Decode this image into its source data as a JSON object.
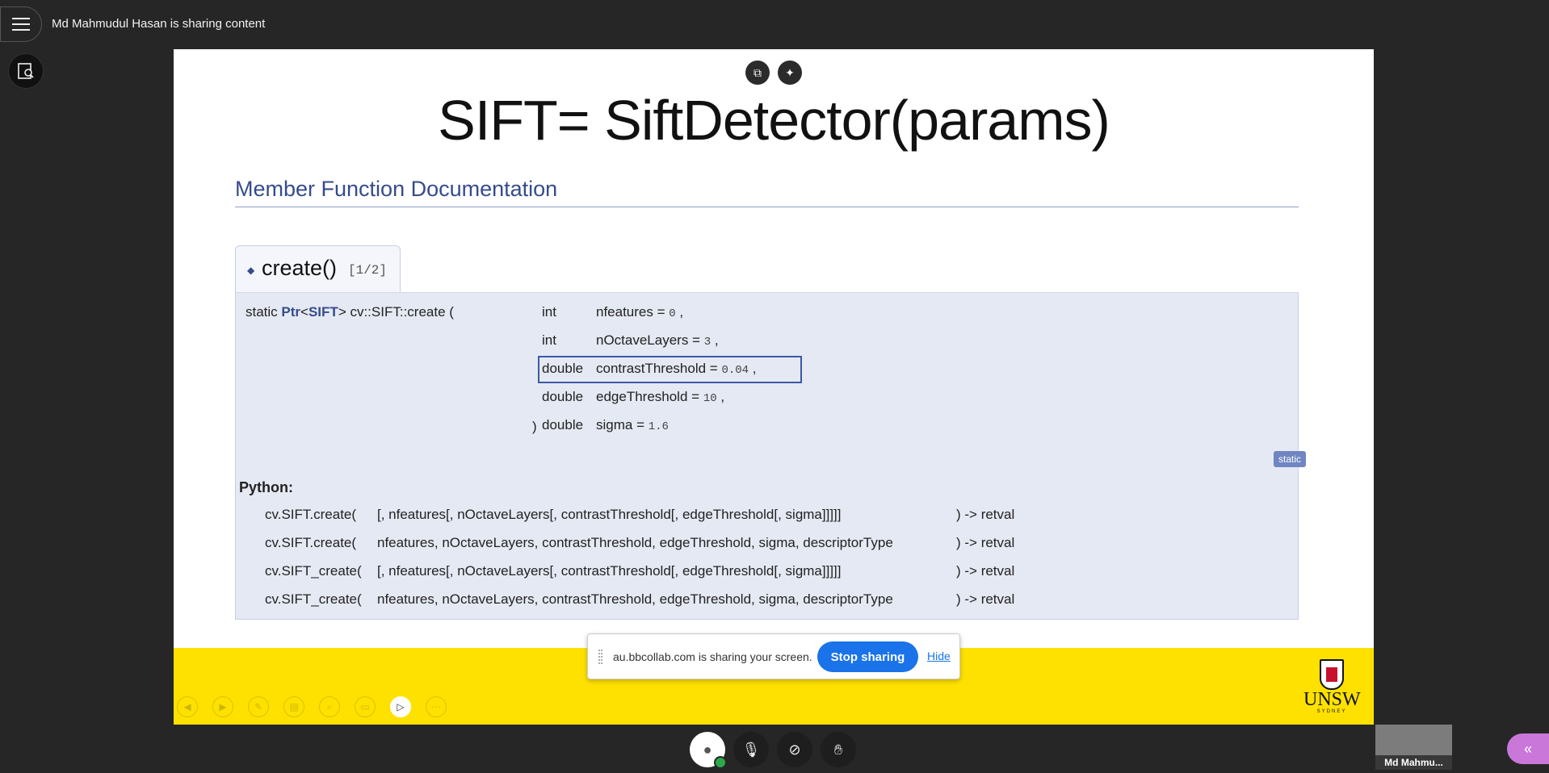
{
  "session": {
    "sharing_title": "Md Mahmudul Hasan is sharing content"
  },
  "slide": {
    "title": "SIFT= SiftDetector(params)",
    "doc_heading": "Member Function Documentation",
    "function_tab": {
      "name": "create()",
      "overload": "[1/2]"
    },
    "signature": {
      "prefix": "static Ptr<SIFT> cv::SIFT::create (",
      "prefix_ptr": "Ptr",
      "prefix_sift": "SIFT",
      "params": [
        {
          "type": "int",
          "name": "nfeatures =",
          "value": "0",
          "sep": ","
        },
        {
          "type": "int",
          "name": "nOctaveLayers =",
          "value": "3",
          "sep": ","
        },
        {
          "type": "double",
          "name": "contrastThreshold =",
          "value": "0.04",
          "sep": ","
        },
        {
          "type": "double",
          "name": "edgeThreshold =",
          "value": "10",
          "sep": ","
        },
        {
          "type": "double",
          "name": "sigma =",
          "value": "1.6",
          "sep": ""
        }
      ],
      "close": ")",
      "badge": "static"
    },
    "python": {
      "label": "Python:",
      "lines": [
        {
          "fn": "cv.SIFT.create(",
          "args": "[, nfeatures[, nOctaveLayers[, contrastThreshold[, edgeThreshold[, sigma]]]]]",
          "ret": ") -> retval"
        },
        {
          "fn": "cv.SIFT.create(",
          "args": "nfeatures, nOctaveLayers, contrastThreshold, edgeThreshold, sigma, descriptorType",
          "ret": ") -> retval"
        },
        {
          "fn": "cv.SIFT_create(",
          "args": "[, nfeatures[, nOctaveLayers[, contrastThreshold[, edgeThreshold[, sigma]]]]]",
          "ret": ") -> retval"
        },
        {
          "fn": "cv.SIFT_create(",
          "args": "nfeatures, nOctaveLayers, contrastThreshold, edgeThreshold, sigma, descriptorType",
          "ret": ") -> retval"
        }
      ]
    },
    "logo": {
      "text": "UNSW",
      "sub": "SYDNEY"
    }
  },
  "share_banner": {
    "message": "au.bbcollab.com is sharing your screen.",
    "stop_label": "Stop sharing",
    "hide_label": "Hide"
  },
  "participant": {
    "name": "Md Mahmu..."
  },
  "colors": {
    "accent": "#1a73e8",
    "band": "#ffe100",
    "doc_link": "#354c8c"
  }
}
